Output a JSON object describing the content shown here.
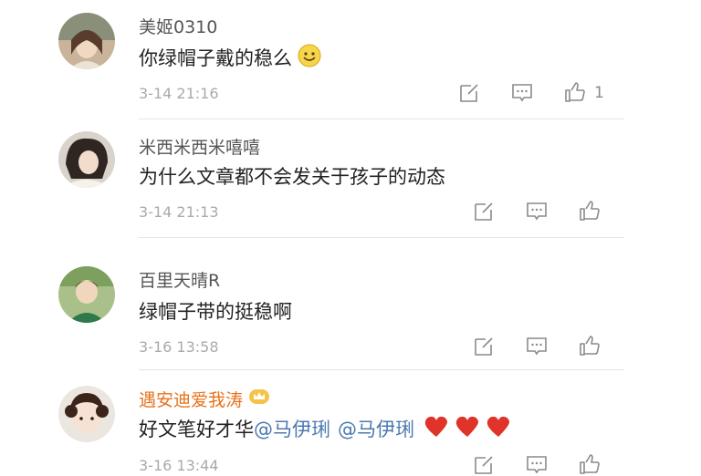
{
  "comments": [
    {
      "username": "美姬0310",
      "content": "你绿帽子戴的稳么",
      "timestamp": "3-14 21:16",
      "like_count": "1"
    },
    {
      "username": "米西米西米嘻嘻",
      "content": "为什么文章都不会发关于孩子的动态",
      "timestamp": "3-14 21:13",
      "like_count": ""
    },
    {
      "username": "百里天晴R",
      "content": "绿帽子带的挺稳啊",
      "timestamp": "3-16 13:58",
      "like_count": ""
    },
    {
      "username": "遇安迪爱我涛",
      "content_prefix": "好文笔好才华",
      "mentions": [
        "@马伊琍",
        "@马伊琍"
      ],
      "timestamp": "3-16 13:44",
      "like_count": ""
    }
  ],
  "icons": {
    "edit": "edit-icon",
    "comment": "comment-icon",
    "like": "like-icon",
    "smile": "smile-emoji-icon",
    "heart": "heart-emoji-icon",
    "crown": "crown-badge-icon"
  },
  "colors": {
    "username": "#555555",
    "vip_username": "#e8721c",
    "mention": "#4a78b0",
    "timestamp": "#aaaaaa",
    "heart": "#e0342a"
  }
}
